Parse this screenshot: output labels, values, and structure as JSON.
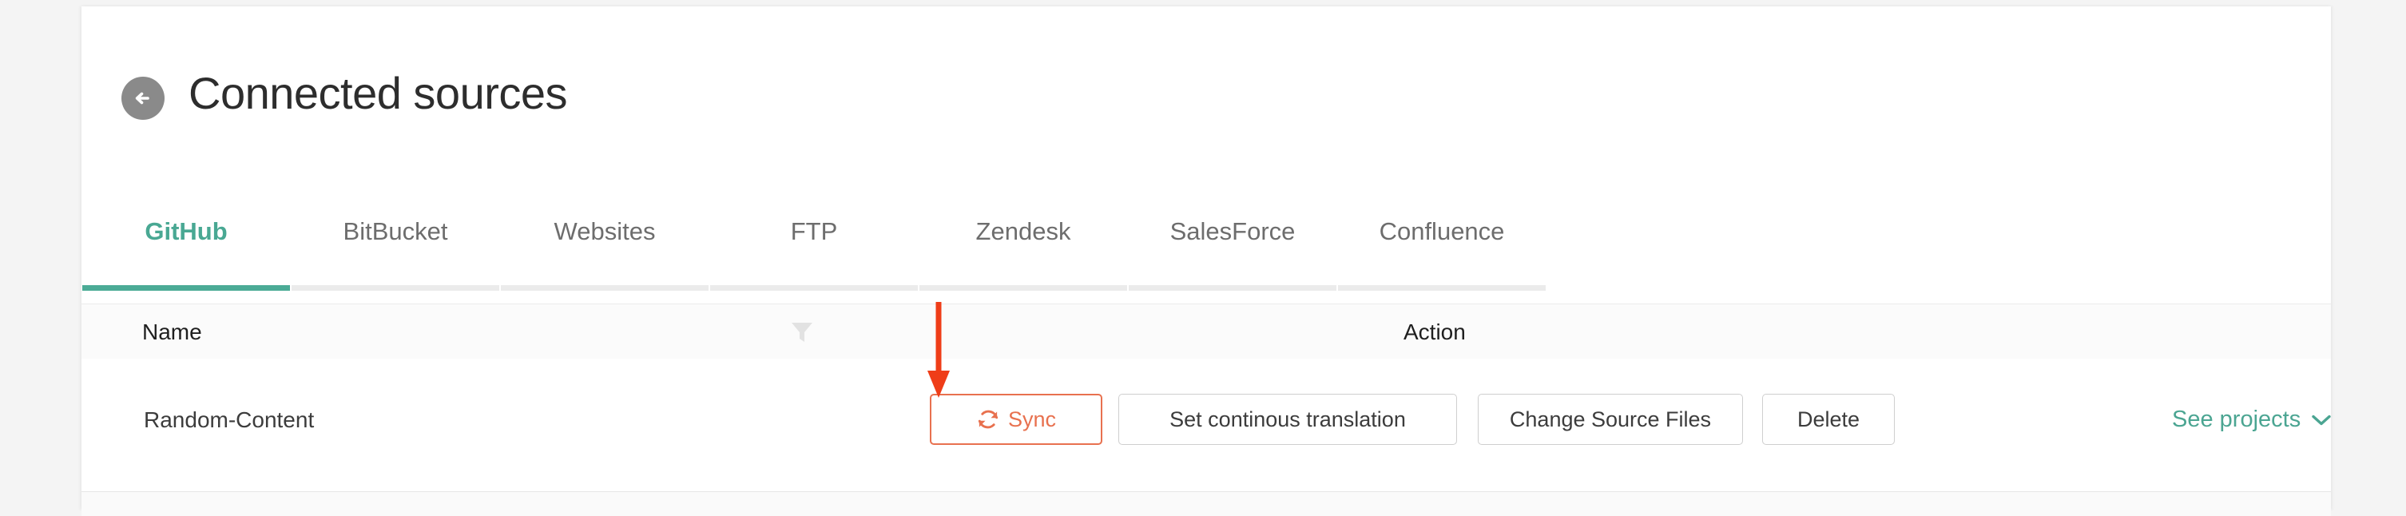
{
  "header": {
    "back_icon": "arrow-left-icon",
    "title": "Connected sources"
  },
  "tabs": [
    {
      "label": "GitHub",
      "active": true
    },
    {
      "label": "BitBucket",
      "active": false
    },
    {
      "label": "Websites",
      "active": false
    },
    {
      "label": "FTP",
      "active": false
    },
    {
      "label": "Zendesk",
      "active": false
    },
    {
      "label": "SalesForce",
      "active": false
    },
    {
      "label": "Confluence",
      "active": false
    }
  ],
  "table": {
    "columns": {
      "name": "Name",
      "filter_icon": "filter-funnel-icon",
      "action": "Action"
    },
    "rows": [
      {
        "name": "Random-Content",
        "actions": [
          {
            "label": "Sync",
            "icon": "sync-refresh-icon",
            "style": "highlighted"
          },
          {
            "label": "Set continous translation",
            "icon": "",
            "style": "default"
          },
          {
            "label": "Change Source Files",
            "icon": "",
            "style": "default"
          },
          {
            "label": "Delete",
            "icon": "",
            "style": "default"
          }
        ],
        "see_projects": "See projects",
        "see_projects_icon": "chevron-down-icon"
      }
    ]
  },
  "annotation": {
    "type": "arrow-down",
    "points_to": "Sync"
  },
  "colors": {
    "accent_teal": "#4bab96",
    "accent_orange": "#e8714f",
    "annotation_red": "#ef3d18",
    "page_bg": "#f4f4f4",
    "card_bg": "#ffffff",
    "header_row_bg": "#fbfbfb"
  }
}
